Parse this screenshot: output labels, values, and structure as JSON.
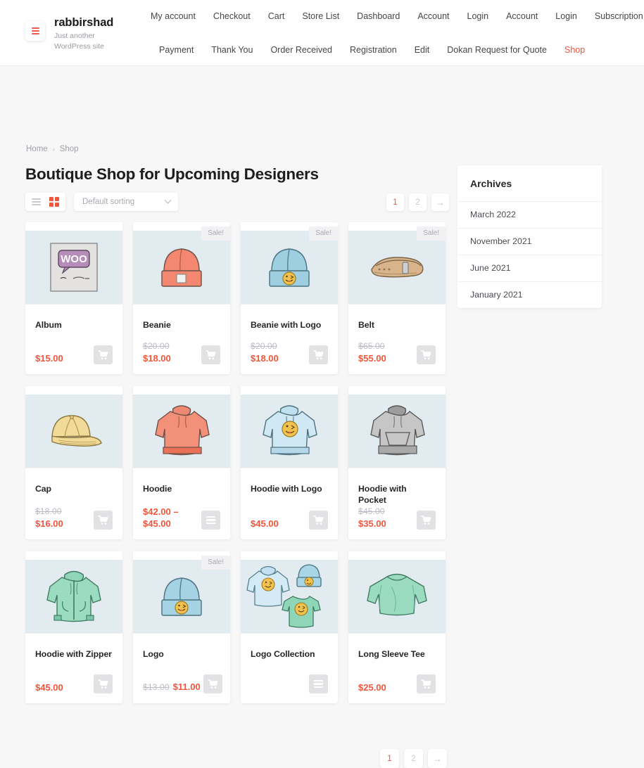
{
  "header": {
    "logo_icon": "hamburger-logo-icon",
    "site_title": "rabbirshad",
    "tagline": "Just another WordPress site",
    "nav_row_1": [
      {
        "label": "My account",
        "active": false
      },
      {
        "label": "Checkout",
        "active": false
      },
      {
        "label": "Cart",
        "active": false
      },
      {
        "label": "Store List",
        "active": false
      },
      {
        "label": "Dashboard",
        "active": false
      },
      {
        "label": "Account",
        "active": false
      },
      {
        "label": "Login",
        "active": false
      },
      {
        "label": "Account",
        "active": false
      },
      {
        "label": "Login",
        "active": false
      },
      {
        "label": "Subscription",
        "active": false
      }
    ],
    "nav_row_2": [
      {
        "label": "Payment",
        "active": false
      },
      {
        "label": "Thank You",
        "active": false
      },
      {
        "label": "Order Received",
        "active": false
      },
      {
        "label": "Registration",
        "active": false
      },
      {
        "label": "Edit",
        "active": false
      },
      {
        "label": "Dokan Request for Quote",
        "active": false
      },
      {
        "label": "Shop",
        "active": true
      }
    ]
  },
  "breadcrumb": {
    "items": [
      "Home",
      "Shop"
    ],
    "separator": "›"
  },
  "page_title": "Boutique Shop for Upcoming Designers",
  "toolbar": {
    "list_view_icon": "list-view-icon",
    "grid_view_icon": "grid-view-icon",
    "active_view": "grid",
    "sorting_value": "Default sorting",
    "sorting_options": [
      "Default sorting"
    ]
  },
  "pagination": {
    "pages": [
      "1",
      "2"
    ],
    "current": "1",
    "next_label": "→"
  },
  "products": [
    {
      "name": "Album",
      "sale_badge": null,
      "price_old": null,
      "price": "$15.00",
      "price_range": null,
      "action_icon": "cart-icon",
      "thumb": "album"
    },
    {
      "name": "Beanie",
      "sale_badge": "Sale!",
      "price_old": "$20.00",
      "price": "$18.00",
      "price_range": null,
      "action_icon": "cart-icon",
      "thumb": "beanie"
    },
    {
      "name": "Beanie with Logo",
      "sale_badge": "Sale!",
      "price_old": "$20.00",
      "price": "$18.00",
      "price_range": null,
      "action_icon": "cart-icon",
      "thumb": "beanie-logo"
    },
    {
      "name": "Belt",
      "sale_badge": "Sale!",
      "price_old": "$65.00",
      "price": "$55.00",
      "price_range": null,
      "action_icon": "cart-icon",
      "thumb": "belt"
    },
    {
      "name": "Cap",
      "sale_badge": null,
      "price_old": "$18.00",
      "price": "$16.00",
      "price_range": null,
      "action_icon": "cart-icon",
      "thumb": "cap"
    },
    {
      "name": "Hoodie",
      "sale_badge": null,
      "price_old": null,
      "price": null,
      "price_range": "$42.00 – $45.00",
      "action_icon": "select-options-icon",
      "thumb": "hoodie"
    },
    {
      "name": "Hoodie with Logo",
      "sale_badge": null,
      "price_old": null,
      "price": "$45.00",
      "price_range": null,
      "action_icon": "cart-icon",
      "thumb": "hoodie-logo"
    },
    {
      "name": "Hoodie with Pocket",
      "sale_badge": null,
      "price_old": "$45.00",
      "price": "$35.00",
      "price_range": null,
      "action_icon": "cart-icon",
      "thumb": "hoodie-pocket"
    },
    {
      "name": "Hoodie with Zipper",
      "sale_badge": null,
      "price_old": null,
      "price": "$45.00",
      "price_range": null,
      "action_icon": "cart-icon",
      "thumb": "hoodie-zipper"
    },
    {
      "name": "Logo",
      "sale_badge": "Sale!",
      "price_old": "$13.00",
      "price": "$11.00",
      "price_range": null,
      "price_inline": true,
      "action_icon": "cart-icon",
      "thumb": "logo-beanie"
    },
    {
      "name": "Logo Collection",
      "sale_badge": null,
      "price_old": null,
      "price": null,
      "price_range": null,
      "action_icon": "select-options-icon",
      "thumb": "logo-collection"
    },
    {
      "name": "Long Sleeve Tee",
      "sale_badge": null,
      "price_old": null,
      "price": "$25.00",
      "price_range": null,
      "action_icon": "cart-icon",
      "thumb": "long-sleeve-tee"
    }
  ],
  "sidebar": {
    "widget_title": "Archives",
    "archives": [
      "March 2022",
      "November 2021",
      "June 2021",
      "January 2021"
    ]
  },
  "colors": {
    "accent": "#f0563c",
    "page_bg": "#f7f7f8",
    "thumb_bg": "#e2ebf0",
    "muted": "#a0a0a8"
  }
}
